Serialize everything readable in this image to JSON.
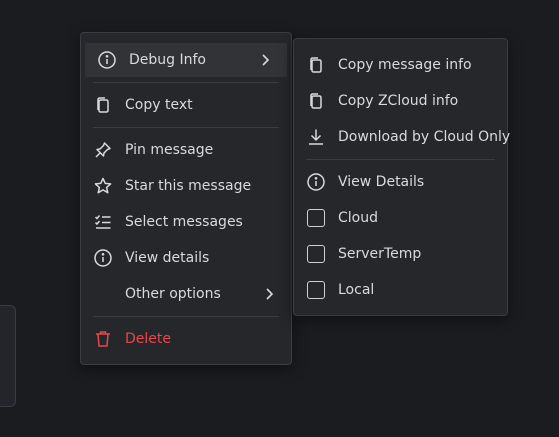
{
  "context_menu": {
    "debug_info": "Debug Info",
    "copy_text": "Copy text",
    "pin_message": "Pin message",
    "star_message": "Star this message",
    "select_messages": "Select messages",
    "view_details": "View details",
    "other_options": "Other options",
    "delete": "Delete"
  },
  "debug_submenu": {
    "copy_message_info": "Copy message info",
    "copy_zcloud_info": "Copy ZCloud info",
    "download_cloud_only": "Download by Cloud Only",
    "view_details": "View Details",
    "cloud": "Cloud",
    "server_temp": "ServerTemp",
    "local": "Local"
  },
  "colors": {
    "background": "#1b1c20",
    "menu_bg": "#26272b",
    "hover_bg": "#323337",
    "text": "#d9dadc",
    "danger": "#e5484d"
  },
  "icons": {
    "debug_info": "info-icon",
    "copy_text": "copy-icon",
    "pin": "pin-icon",
    "star": "star-icon",
    "select": "list-check-icon",
    "view_details": "info-icon",
    "delete": "trash-icon",
    "copy_message_info": "copy-icon",
    "copy_zcloud_info": "copy-icon",
    "download": "download-icon",
    "checkbox": "checkbox-icon"
  }
}
